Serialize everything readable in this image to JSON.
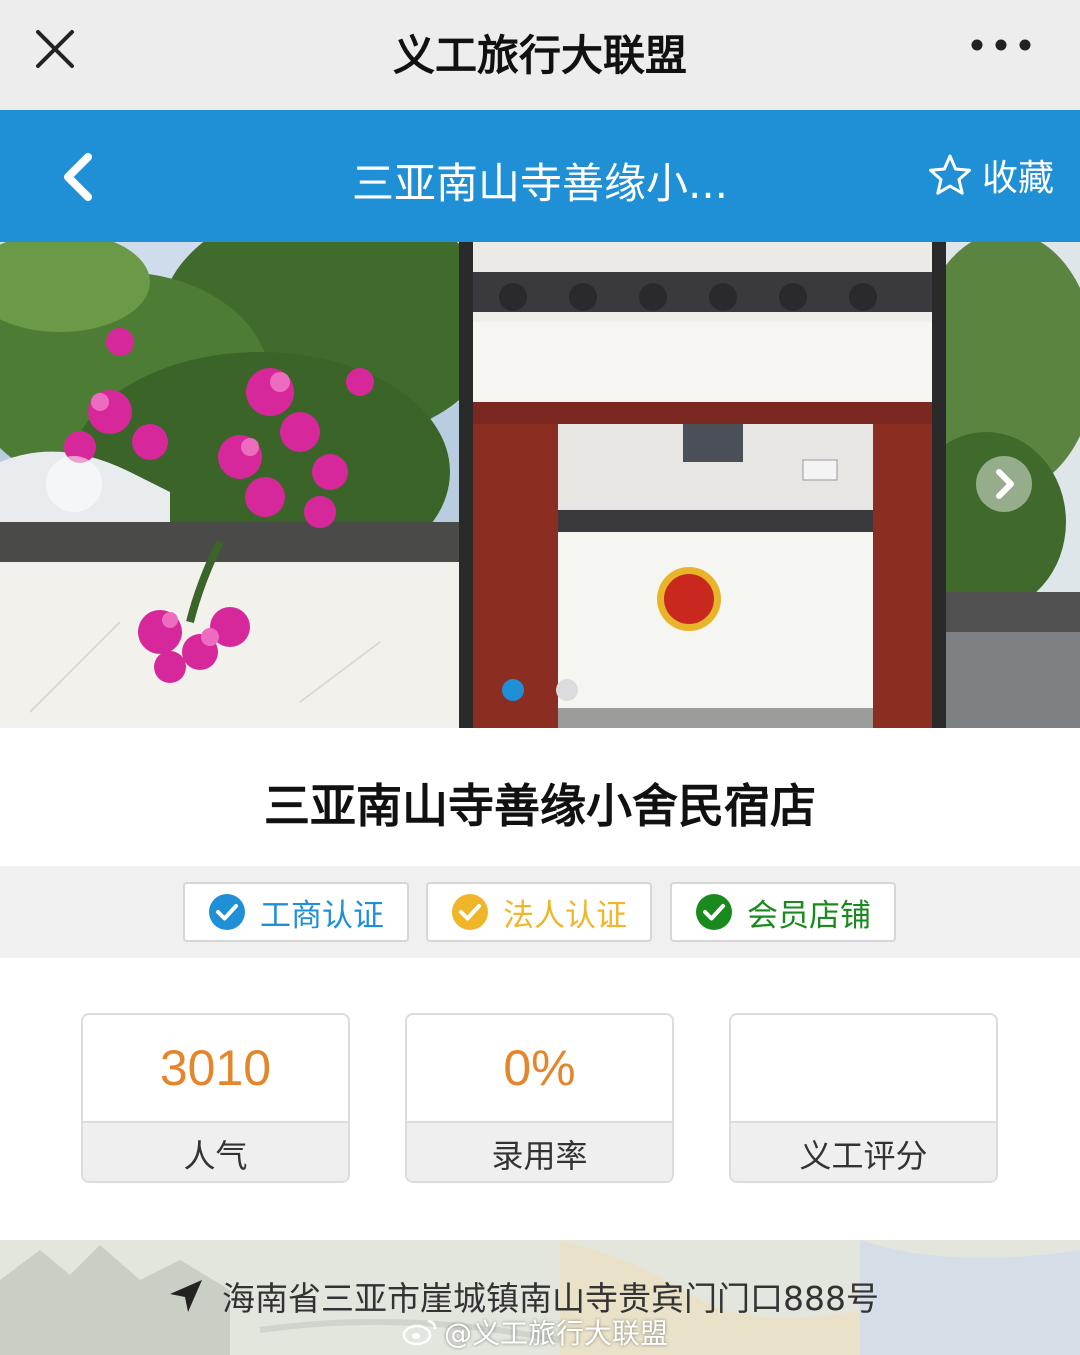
{
  "wechat_bar": {
    "title": "义工旅行大联盟"
  },
  "nav": {
    "title": "三亚南山寺善缘小...",
    "favorite_label": "收藏"
  },
  "carousel": {
    "slide_count": 2,
    "active_index": 0
  },
  "shop": {
    "name": "三亚南山寺善缘小舍民宿店"
  },
  "badges": [
    {
      "label": "工商认证",
      "color": "#1f8fd6"
    },
    {
      "label": "法人认证",
      "color": "#f0b62a"
    },
    {
      "label": "会员店铺",
      "color": "#1a8a1f"
    }
  ],
  "stats": [
    {
      "value": "3010",
      "label": "人气"
    },
    {
      "value": "0%",
      "label": "录用率"
    },
    {
      "value": "",
      "label": "义工评分"
    }
  ],
  "location": {
    "address": "海南省三亚市崖城镇南山寺贵宾门门口888号"
  },
  "watermark": "@义工旅行大联盟"
}
